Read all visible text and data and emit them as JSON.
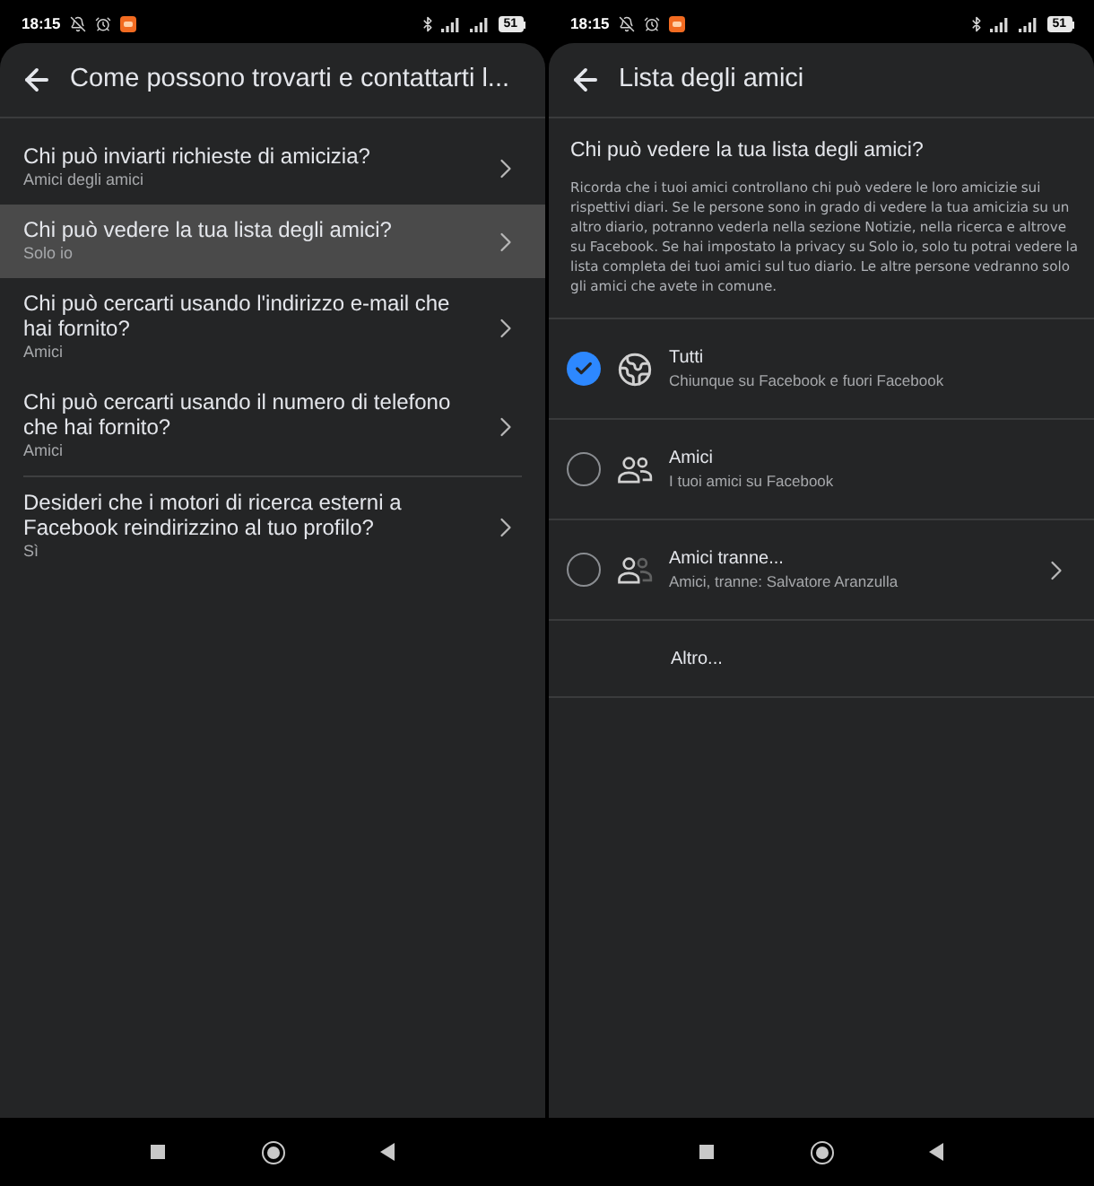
{
  "screens": [
    {
      "kind": "settings_list",
      "status_bar": {
        "time": "18:15",
        "battery": "51"
      },
      "header": {
        "title": "Come possono trovarti e contattarti l..."
      },
      "groups": [
        {
          "items": [
            {
              "title": "Chi può inviarti richieste di amicizia?",
              "value": "Amici degli amici",
              "selected": false
            },
            {
              "title": "Chi può vedere la tua lista degli amici?",
              "value": "Solo io",
              "selected": true
            },
            {
              "title": "Chi può cercarti usando l'indirizzo e-mail che hai fornito?",
              "value": "Amici",
              "selected": false
            },
            {
              "title": "Chi può cercarti usando il numero di telefono che hai fornito?",
              "value": "Amici",
              "selected": false
            }
          ]
        },
        {
          "items": [
            {
              "title": "Desideri che i motori di ricerca esterni a Facebook reindirizzino al tuo profilo?",
              "value": "Sì",
              "selected": false
            }
          ]
        }
      ]
    },
    {
      "kind": "audience_picker",
      "status_bar": {
        "time": "18:15",
        "battery": "51"
      },
      "header": {
        "title": "Lista degli amici"
      },
      "question": "Chi può vedere la tua lista degli amici?",
      "description": "Ricorda che i tuoi amici controllano chi può vedere le loro amicizie sui rispettivi diari. Se le persone sono in grado di vedere la tua amicizia su un altro diario, potranno vederla nella sezione Notizie, nella ricerca e altrove su Facebook. Se hai impostato la privacy su Solo io, solo tu potrai vedere la lista completa dei tuoi amici sul tuo diario. Le altre persone vedranno solo gli amici che avete in comune.",
      "options": [
        {
          "kind": "public",
          "label": "Tutti",
          "description": "Chiunque su Facebook e fuori Facebook",
          "selected": true
        },
        {
          "kind": "friends",
          "label": "Amici",
          "description": "I tuoi amici su Facebook",
          "selected": false
        },
        {
          "kind": "friends_except",
          "label": "Amici tranne...",
          "description": "Amici, tranne: Salvatore Aranzulla",
          "selected": false
        },
        {
          "kind": "more",
          "label": "Altro..."
        }
      ]
    }
  ]
}
